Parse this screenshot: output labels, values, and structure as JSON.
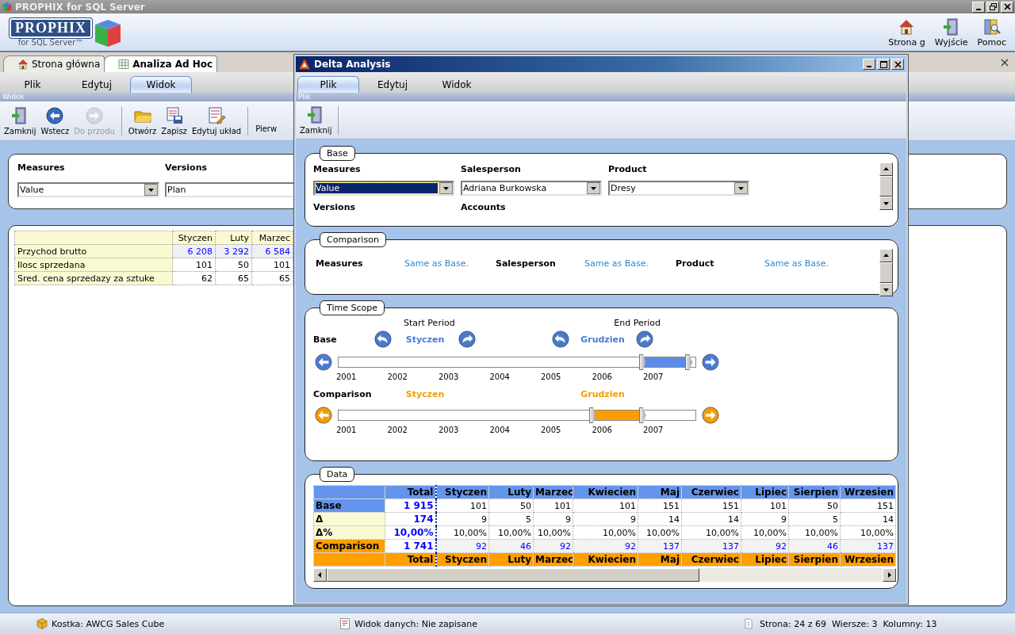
{
  "app": {
    "title": "PROPHIX for SQL Server",
    "logo": {
      "name": "PROPHIX",
      "subtitle": "for SQL Server™"
    }
  },
  "header_actions": [
    {
      "label": "Strona g",
      "kind": "home"
    },
    {
      "label": "Wyjście",
      "kind": "exit"
    },
    {
      "label": "Pomoc",
      "kind": "help"
    }
  ],
  "document_tabs": [
    {
      "label": "Strona główna",
      "kind": "home",
      "selected": false
    },
    {
      "label": "Analiza Ad Hoc",
      "kind": "grid",
      "selected": true
    }
  ],
  "menu": [
    {
      "label": "Plik",
      "selected": false
    },
    {
      "label": "Edytuj",
      "selected": false
    },
    {
      "label": "Widok",
      "selected": true
    }
  ],
  "ribbon_caption": "Widok",
  "toolbar": [
    {
      "label": "Zamknij",
      "kind": "exit",
      "disabled": false
    },
    {
      "label": "Wstecz",
      "kind": "back",
      "disabled": false
    },
    {
      "label": "Do przodu",
      "kind": "forward",
      "disabled": true
    },
    {
      "kind": "separator"
    },
    {
      "label": "Otwórz",
      "kind": "open",
      "disabled": false
    },
    {
      "label": "Zapisz",
      "kind": "save",
      "disabled": false
    },
    {
      "label": "Edytuj układ",
      "kind": "layout",
      "disabled": false
    },
    {
      "kind": "separator"
    },
    {
      "label": "Pierw",
      "kind": "text"
    }
  ],
  "filters": [
    {
      "label": "Measures",
      "value": "Value"
    },
    {
      "label": "Versions",
      "value": "Plan"
    }
  ],
  "report": {
    "columns": [
      "Styczen",
      "Luty",
      "Marzec"
    ],
    "rows": [
      {
        "label": "Przychod brutto",
        "editable": true,
        "cells": [
          "6 208",
          "3 292",
          "6 584"
        ]
      },
      {
        "label": "Ilosc sprzedana",
        "editable": false,
        "cells": [
          "101",
          "50",
          "101"
        ]
      },
      {
        "label": "Sred. cena sprzedazy za sztuke",
        "editable": false,
        "cells": [
          "62",
          "65",
          "65"
        ]
      }
    ]
  },
  "dialog": {
    "title": "Delta Analysis",
    "menu": [
      {
        "label": "Plik",
        "selected": true
      },
      {
        "label": "Edytuj",
        "selected": false
      },
      {
        "label": "Widok",
        "selected": false
      }
    ],
    "ribbon_caption": "Plik",
    "toolbar": [
      {
        "label": "Zamknij",
        "kind": "exit"
      }
    ],
    "base": {
      "title": "Base",
      "fields": [
        {
          "label": "Measures",
          "value": "Value",
          "focused": true
        },
        {
          "label": "Salesperson",
          "value": "Adriana Burkowska",
          "focused": false
        },
        {
          "label": "Product",
          "value": "Dresy",
          "focused": false
        }
      ],
      "more_labels": [
        "Versions",
        "Accounts"
      ]
    },
    "comparison": {
      "title": "Comparison",
      "fields": [
        {
          "label": "Measures",
          "value": "Same as Base."
        },
        {
          "label": "Salesperson",
          "value": "Same as Base."
        },
        {
          "label": "Product",
          "value": "Same as Base."
        }
      ]
    },
    "time_scope": {
      "title": "Time Scope",
      "start_heading": "Start Period",
      "end_heading": "End Period",
      "rows": [
        {
          "label": "Base",
          "kind": "base",
          "start": "Styczen",
          "end": "Grudzien",
          "range": {
            "start": {
              "level": 0.85
            },
            "end": {
              "level": 0.98
            }
          },
          "years": [
            "2001",
            "2002",
            "2003",
            "2004",
            "2005",
            "2006",
            "2007"
          ]
        },
        {
          "label": "Comparison",
          "kind": "comparison",
          "start": "Styczen",
          "end": "Grudzien",
          "range": {
            "start": {
              "level": 0.71
            },
            "end": {
              "level": 0.85
            }
          },
          "years": [
            "2001",
            "2002",
            "2003",
            "2004",
            "2005",
            "2006",
            "2007"
          ]
        }
      ]
    },
    "data": {
      "title": "Data",
      "columns": [
        "Total",
        "Styczen",
        "Luty",
        "Marzec",
        "Kwiecien",
        "Maj",
        "Czerwiec",
        "Lipiec",
        "Sierpien",
        "Wrzesien"
      ],
      "rows": [
        {
          "label": "Base",
          "kind": "base",
          "cells": [
            "1 915",
            "101",
            "50",
            "101",
            "101",
            "151",
            "151",
            "101",
            "50",
            "151"
          ]
        },
        {
          "label": "Δ",
          "kind": "delta",
          "cells": [
            "174",
            "9",
            "5",
            "9",
            "9",
            "14",
            "14",
            "9",
            "5",
            "14"
          ]
        },
        {
          "label": "Δ%",
          "kind": "delta",
          "cells": [
            "10,00%",
            "10,00%",
            "10,00%",
            "10,00%",
            "10,00%",
            "10,00%",
            "10,00%",
            "10,00%",
            "10,00%",
            "10,00%"
          ]
        },
        {
          "label": "Comparison",
          "kind": "comparison",
          "cells": [
            "1 741",
            "92",
            "46",
            "92",
            "92",
            "137",
            "137",
            "92",
            "46",
            "137"
          ]
        }
      ],
      "footer": [
        "Total",
        "Styczen",
        "Luty",
        "Marzec",
        "Kwiecien",
        "Maj",
        "Czerwiec",
        "Lipiec",
        "Sierpien",
        "Wrzesien"
      ]
    }
  },
  "status_bar": [
    {
      "text": "Kostka: AWCG Sales Cube",
      "kind": "cube"
    },
    {
      "text": "Widok danych: Nie zapisane",
      "kind": "view"
    },
    {
      "text": "Strona: 24 z 69",
      "kind": "page"
    },
    {
      "text": "Wiersze: 3",
      "kind": "plain"
    },
    {
      "text": "Kolumny: 13",
      "kind": "plain"
    }
  ]
}
